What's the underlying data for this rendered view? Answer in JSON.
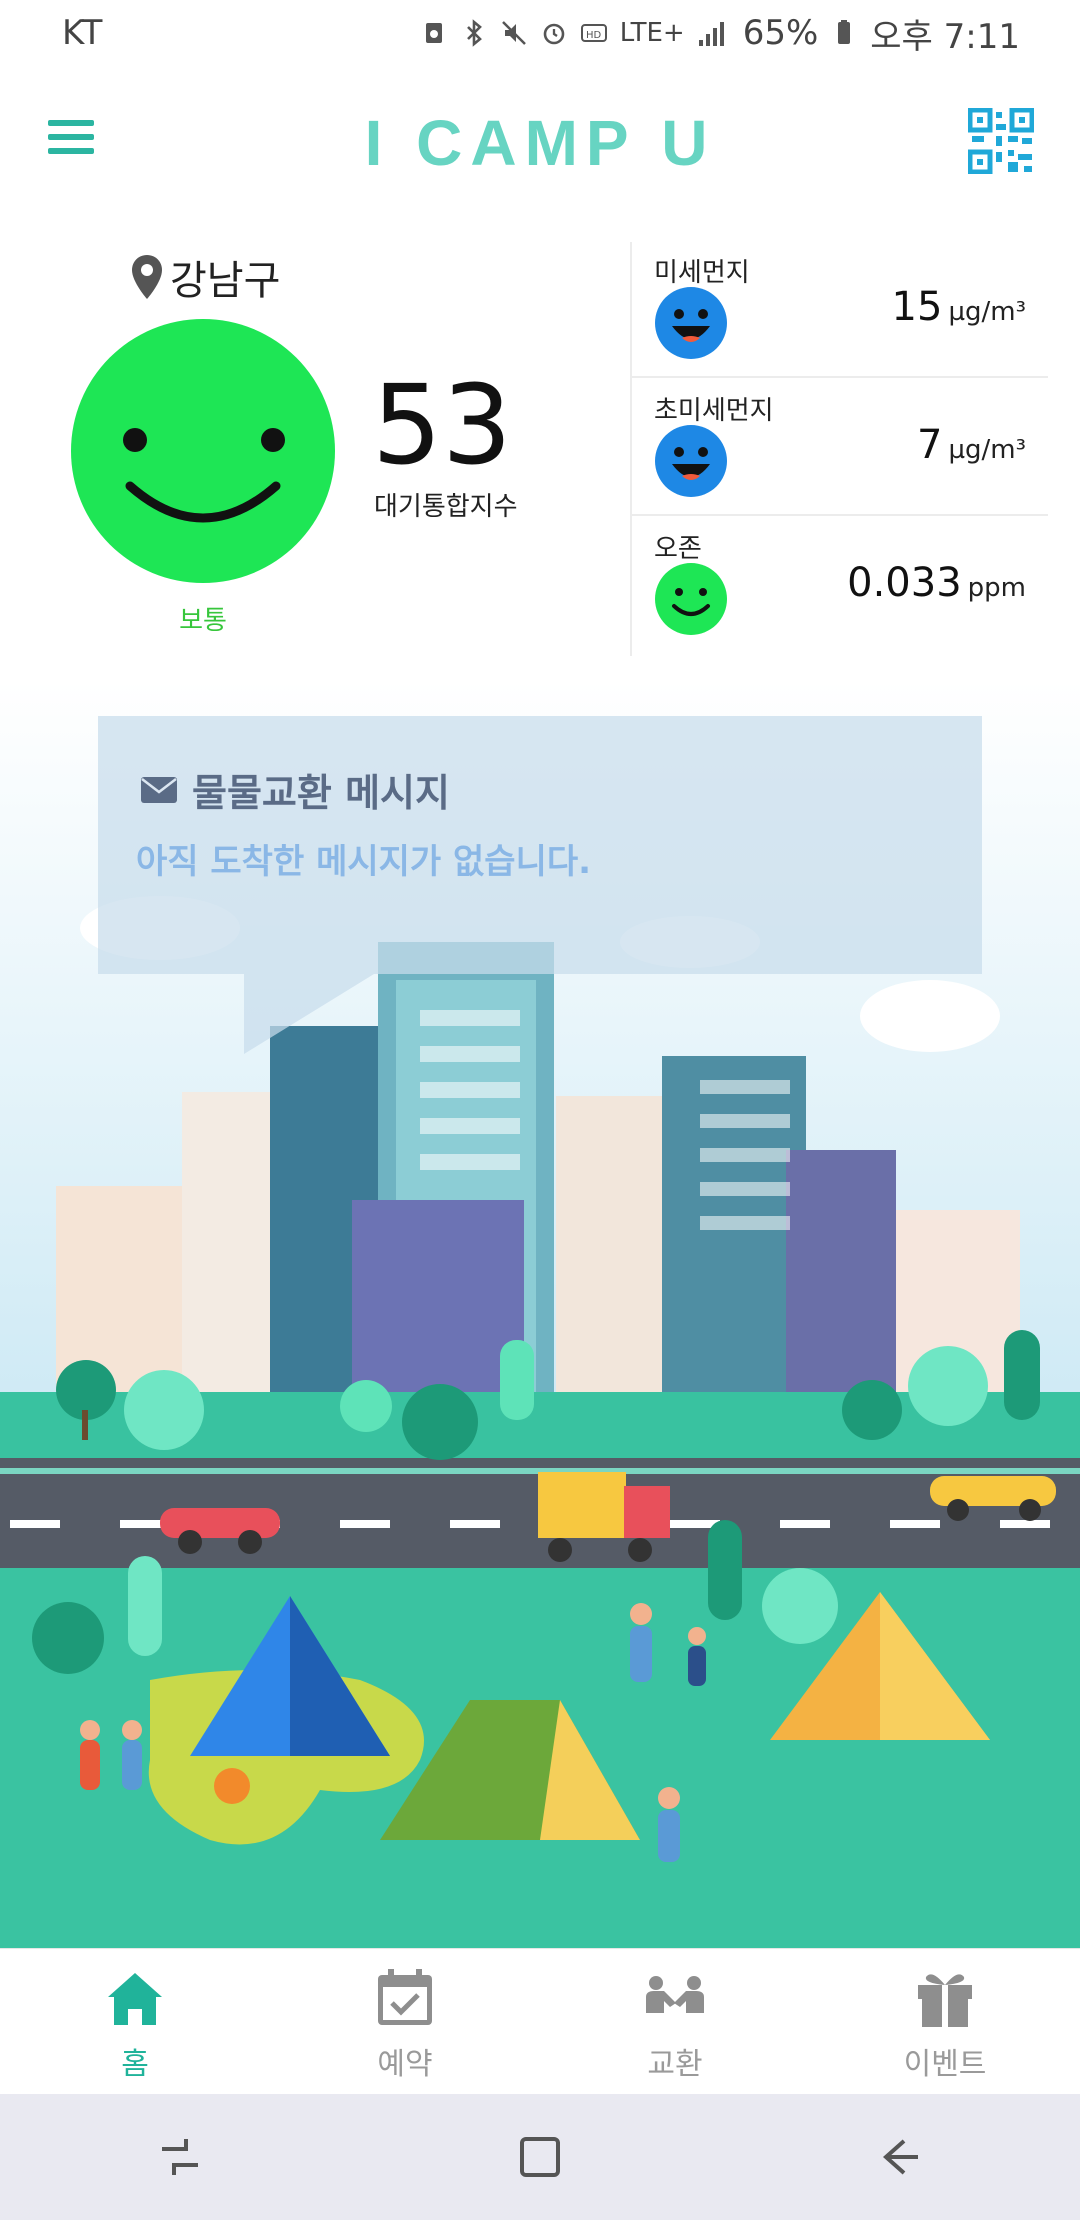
{
  "status_bar": {
    "carrier": "KT",
    "network": "LTE+",
    "battery": "65%",
    "time": "오후 7:11",
    "icons": [
      "recycle-notification-icon",
      "bluetooth-icon",
      "mute-icon",
      "alarm-icon",
      "hd-voice-icon",
      "lte-icon",
      "signal-icon",
      "battery-icon"
    ]
  },
  "app_bar": {
    "title": "I CAMP U",
    "menu_icon": "hamburger-menu-icon",
    "qr_icon": "qr-code-icon",
    "accent_color": "#2bb5a1",
    "title_color": "#67d4c2"
  },
  "air_quality": {
    "location": "강남구",
    "overall_status": "보통",
    "aqi_value": "53",
    "aqi_label": "대기통합지수",
    "metrics": [
      {
        "name": "미세먼지",
        "value": "15",
        "unit": "µg/m³",
        "face_color": "#1e88e5",
        "mood": "happy"
      },
      {
        "name": "초미세먼지",
        "value": "7",
        "unit": "µg/m³",
        "face_color": "#1e88e5",
        "mood": "happy"
      },
      {
        "name": "오존",
        "value": "0.033",
        "unit": "ppm",
        "face_color": "#1ee655",
        "mood": "smile"
      }
    ],
    "status_color": "#1ee655"
  },
  "message_card": {
    "title": "물물교환 메시지",
    "body": "아직 도착한 메시지가 없습니다."
  },
  "bottom_nav": {
    "items": [
      {
        "label": "홈",
        "icon": "home-icon",
        "active": true
      },
      {
        "label": "예약",
        "icon": "calendar-check-icon",
        "active": false
      },
      {
        "label": "교환",
        "icon": "exchange-people-icon",
        "active": false
      },
      {
        "label": "이벤트",
        "icon": "gift-icon",
        "active": false
      }
    ],
    "active_color": "#20b39a",
    "inactive_color": "#9a9a9a"
  },
  "system_nav": {
    "buttons": [
      "recent-apps-icon",
      "home-square-icon",
      "back-icon"
    ]
  }
}
